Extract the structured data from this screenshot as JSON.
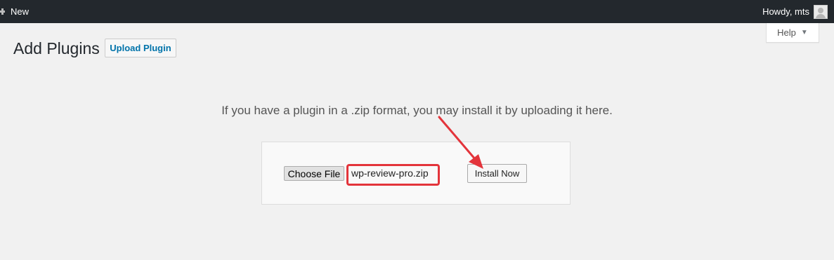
{
  "admin_bar": {
    "new_label": "New",
    "howdy_label": "Howdy, mts"
  },
  "help_tab": {
    "label": "Help",
    "caret": "▼"
  },
  "page": {
    "title": "Add Plugins",
    "upload_button_label": "Upload Plugin",
    "instructions": "If you have a plugin in a .zip format, you may install it by uploading it here."
  },
  "upload_form": {
    "choose_file_label": "Choose File",
    "selected_file": "wp-review-pro.zip",
    "install_button_label": "Install Now"
  },
  "colors": {
    "admin_bar_bg": "#23282d",
    "page_bg": "#f1f1f1",
    "link_blue": "#0073aa",
    "annotation_red": "#e3343b"
  }
}
